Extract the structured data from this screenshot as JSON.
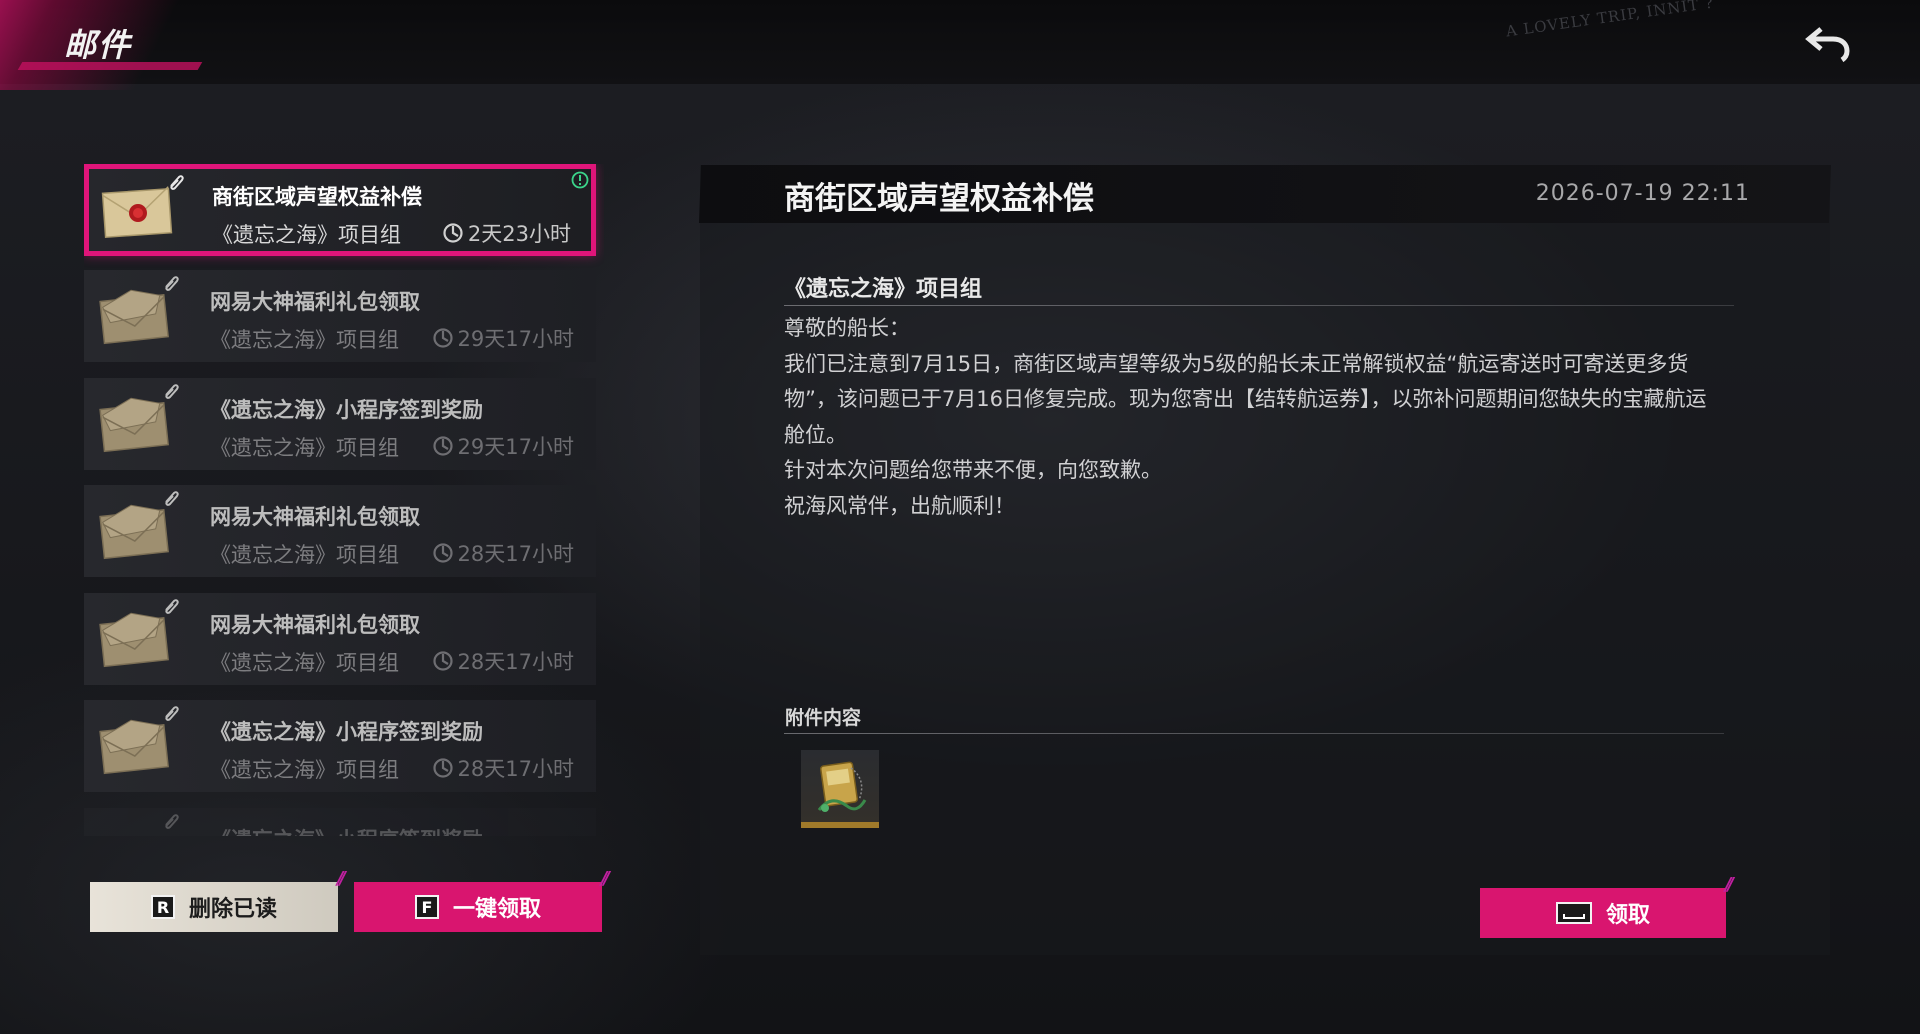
{
  "header": {
    "title": "邮件",
    "scribble": "A LOVELY TRIP, INNIT ?"
  },
  "mail_list": [
    {
      "title": "商街区域声望权益补偿",
      "sender": "《遗忘之海》项目组",
      "time_left": "2天23小时",
      "selected": true,
      "opened": false,
      "has_new_badge": true
    },
    {
      "title": "网易大神福利礼包领取",
      "sender": "《遗忘之海》项目组",
      "time_left": "29天17小时",
      "selected": false,
      "opened": true
    },
    {
      "title": "《遗忘之海》小程序签到奖励",
      "sender": "《遗忘之海》项目组",
      "time_left": "29天17小时",
      "selected": false,
      "opened": true
    },
    {
      "title": "网易大神福利礼包领取",
      "sender": "《遗忘之海》项目组",
      "time_left": "28天17小时",
      "selected": false,
      "opened": true
    },
    {
      "title": "网易大神福利礼包领取",
      "sender": "《遗忘之海》项目组",
      "time_left": "28天17小时",
      "selected": false,
      "opened": true
    },
    {
      "title": "《遗忘之海》小程序签到奖励",
      "sender": "《遗忘之海》项目组",
      "time_left": "28天17小时",
      "selected": false,
      "opened": true
    },
    {
      "title": "《遗忘之海》小程序签到奖励",
      "sender": "",
      "time_left": "",
      "selected": false,
      "opened": true
    }
  ],
  "buttons": {
    "delete_read": {
      "key": "R",
      "label": "删除已读"
    },
    "claim_all": {
      "key": "F",
      "label": "一键领取"
    },
    "claim": {
      "label": "领取"
    }
  },
  "detail": {
    "title": "商街区域声望权益补偿",
    "date": "2026-07-19 22:11",
    "sender": "《遗忘之海》项目组",
    "body": [
      "尊敬的船长：",
      "我们已注意到7月15日，商街区域声望等级为5级的船长未正常解锁权益“航运寄送时可寄送更多货物”，该问题已于7月16日修复完成。现为您寄出【结转航运券】，以弥补问题期间您缺失的宝藏航运舱位。",
      "针对本次问题给您带来不便，向您致歉。",
      "祝海风常伴，出航顺利！"
    ],
    "attachments_label": "附件内容",
    "attachments": [
      {
        "icon": "voucher-item-icon"
      }
    ]
  },
  "colors": {
    "accent": "#d9156f",
    "accent_border": "#e0157a",
    "new_badge": "#3bd48a"
  }
}
